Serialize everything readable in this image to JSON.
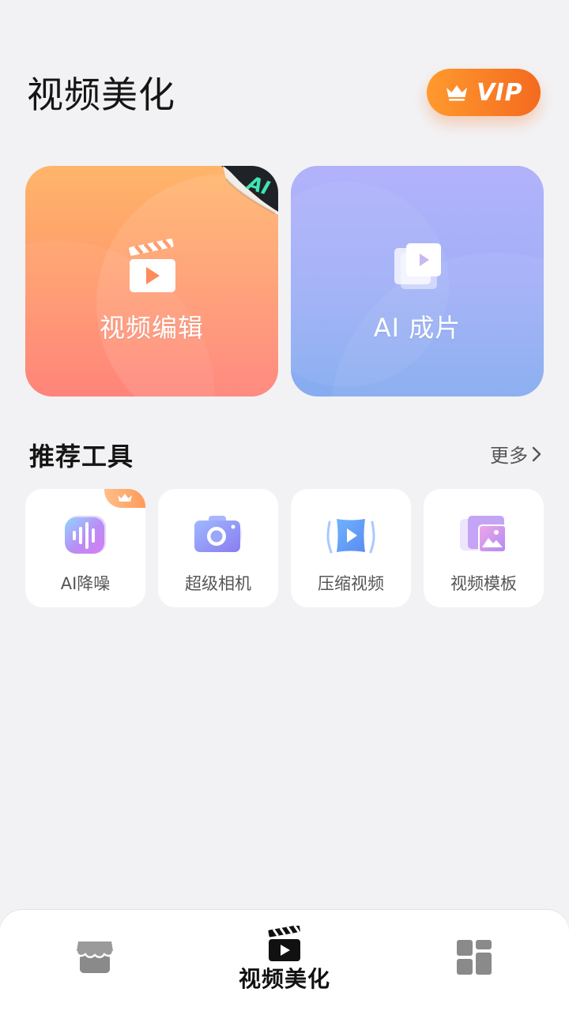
{
  "header": {
    "title": "视频美化",
    "vip_label": "VIP"
  },
  "feature_cards": [
    {
      "label": "视频编辑",
      "badge": "AI",
      "icon": "clapperboard-play-icon"
    },
    {
      "label": "AI 成片",
      "icon": "stacked-video-icon"
    }
  ],
  "tools_section": {
    "title": "推荐工具",
    "more_label": "更多"
  },
  "tools": [
    {
      "label": "AI降噪",
      "icon": "audio-wave-icon",
      "vip": true
    },
    {
      "label": "超级相机",
      "icon": "camera-icon"
    },
    {
      "label": "压缩视频",
      "icon": "compress-video-icon"
    },
    {
      "label": "视频模板",
      "icon": "template-icon"
    }
  ],
  "bottom_nav": [
    {
      "name": "store",
      "icon": "store-icon"
    },
    {
      "name": "video",
      "label": "视频美化",
      "icon": "clapperboard-icon",
      "active": true
    },
    {
      "name": "apps",
      "icon": "apps-grid-icon"
    }
  ],
  "colors": {
    "background": "#f2f2f4",
    "vip_orange": "#f46a1f",
    "card_orange": "#ff9d6c",
    "card_purple": "#a2b0f7"
  }
}
